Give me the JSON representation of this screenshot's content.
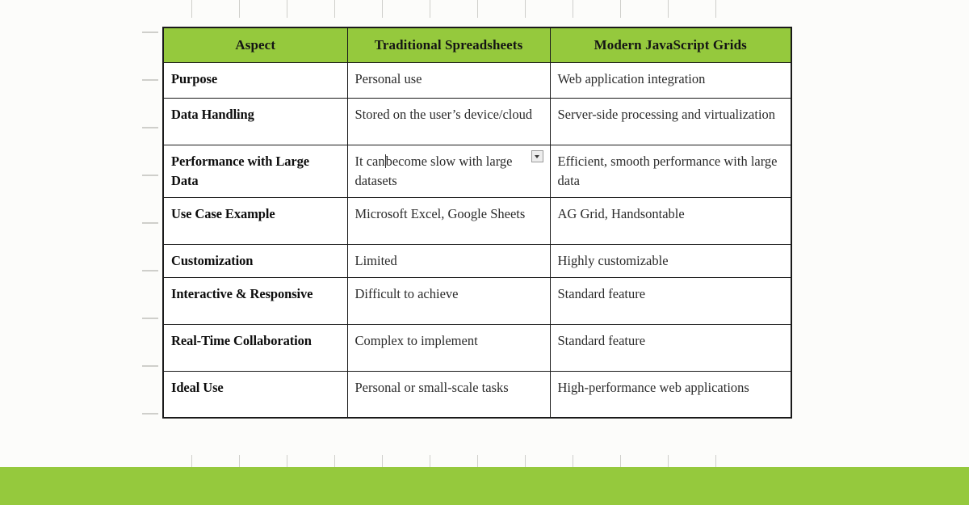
{
  "document": {
    "background_color": "#fcfcfa",
    "accent_color": "#95c93d",
    "border_color": "#1a1a1a"
  },
  "table": {
    "headers": [
      "Aspect",
      "Traditional Spreadsheets",
      "Modern JavaScript Grids"
    ],
    "rows": [
      {
        "aspect": "Purpose",
        "traditional": "Personal use",
        "modern": "Web application integration"
      },
      {
        "aspect": "Data Handling",
        "traditional": "Stored on the user’s device/cloud",
        "modern": "Server-side processing and virtualization"
      },
      {
        "aspect": "Performance with Large Data",
        "traditional_before_caret": "It can",
        "traditional_after_caret": "become slow with large datasets",
        "modern": "Efficient, smooth performance with large data"
      },
      {
        "aspect": "Use Case Example",
        "traditional": "Microsoft Excel, Google Sheets",
        "modern": "AG Grid, Handsontable"
      },
      {
        "aspect": "Customization",
        "traditional": "Limited",
        "modern": "Highly customizable"
      },
      {
        "aspect": "Interactive & Responsive",
        "traditional": "Difficult to achieve",
        "modern": "Standard feature"
      },
      {
        "aspect": "Real-Time Collaboration",
        "traditional": "Complex to implement",
        "modern": "Standard feature"
      },
      {
        "aspect": "Ideal Use",
        "traditional": "Personal or small-scale tasks",
        "modern": "High-performance web applications"
      }
    ]
  },
  "overlays": {
    "dropdown_button_icon": "chevron-down-icon",
    "text_caret": "text-cursor"
  }
}
